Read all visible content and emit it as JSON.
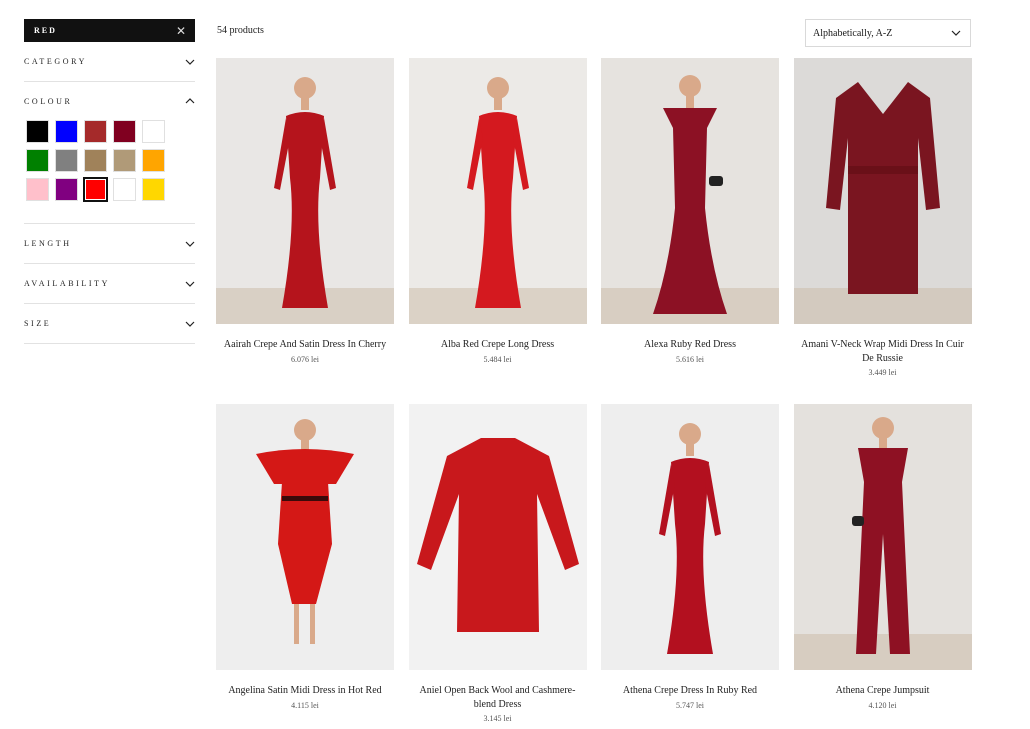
{
  "active_filter": {
    "label": "RED",
    "remove_icon": "close-icon"
  },
  "facets": {
    "category": "CATEGORY",
    "colour": "COLOUR",
    "length": "LENGTH",
    "availability": "AVAILABILITY",
    "size": "SIZE"
  },
  "colour_swatches": [
    {
      "name": "black",
      "color": "#000000",
      "selected": false
    },
    {
      "name": "blue",
      "color": "#0000ff",
      "selected": false
    },
    {
      "name": "brown-red",
      "color": "#a52a2a",
      "selected": false
    },
    {
      "name": "burgundy",
      "color": "#800020",
      "selected": false
    },
    {
      "name": "white",
      "color": "#ffffff",
      "selected": false
    },
    {
      "name": "green",
      "color": "#008000",
      "selected": false
    },
    {
      "name": "grey",
      "color": "#808080",
      "selected": false
    },
    {
      "name": "gold",
      "color": "#a0825a",
      "selected": false
    },
    {
      "name": "beige",
      "color": "#b09a78",
      "selected": false
    },
    {
      "name": "orange",
      "color": "#ffa500",
      "selected": false
    },
    {
      "name": "pink",
      "color": "#ffc0cb",
      "selected": false
    },
    {
      "name": "purple",
      "color": "#800080",
      "selected": false
    },
    {
      "name": "red",
      "color": "#ff0000",
      "selected": true
    },
    {
      "name": "ivory",
      "color": "#ffffff",
      "selected": false
    },
    {
      "name": "yellow",
      "color": "#ffd700",
      "selected": false
    }
  ],
  "toolbar": {
    "count": "54 products",
    "sort_value": "Alphabetically, A-Z"
  },
  "products": [
    {
      "name": "Aairah Crepe And Satin Dress In Cherry",
      "price": "6.076 lei",
      "bg": "#e9e7e5",
      "dress": "#b5141c",
      "style": "gown"
    },
    {
      "name": "Alba Red Crepe Long Dress",
      "price": "5.484 lei",
      "bg": "#eceae7",
      "dress": "#d4191f",
      "style": "gown"
    },
    {
      "name": "Alexa Ruby Red Dress",
      "price": "5.616 lei",
      "bg": "#e6e3df",
      "dress": "#8c1124",
      "style": "mermaid"
    },
    {
      "name": "Amani V-Neck Wrap Midi Dress In Cuir De Russie",
      "price": "3.449 lei",
      "bg": "#dcdad8",
      "dress": "#7a1520",
      "style": "knit"
    },
    {
      "name": "Angelina Satin Midi Dress in Hot Red",
      "price": "4.115 lei",
      "bg": "#eeeeee",
      "dress": "#d41816",
      "style": "midi"
    },
    {
      "name": "Aniel Open Back Wool and Cashmere-blend Dress",
      "price": "3.145 lei",
      "bg": "#f2f2f2",
      "dress": "#c8181c",
      "style": "sweater"
    },
    {
      "name": "Athena Crepe Dress In Ruby Red",
      "price": "5.747 lei",
      "bg": "#eeeeee",
      "dress": "#b3101f",
      "style": "gown"
    },
    {
      "name": "Athena Crepe Jumpsuit",
      "price": "4.120 lei",
      "bg": "#e4e1dd",
      "dress": "#8e1123",
      "style": "jumpsuit"
    }
  ]
}
